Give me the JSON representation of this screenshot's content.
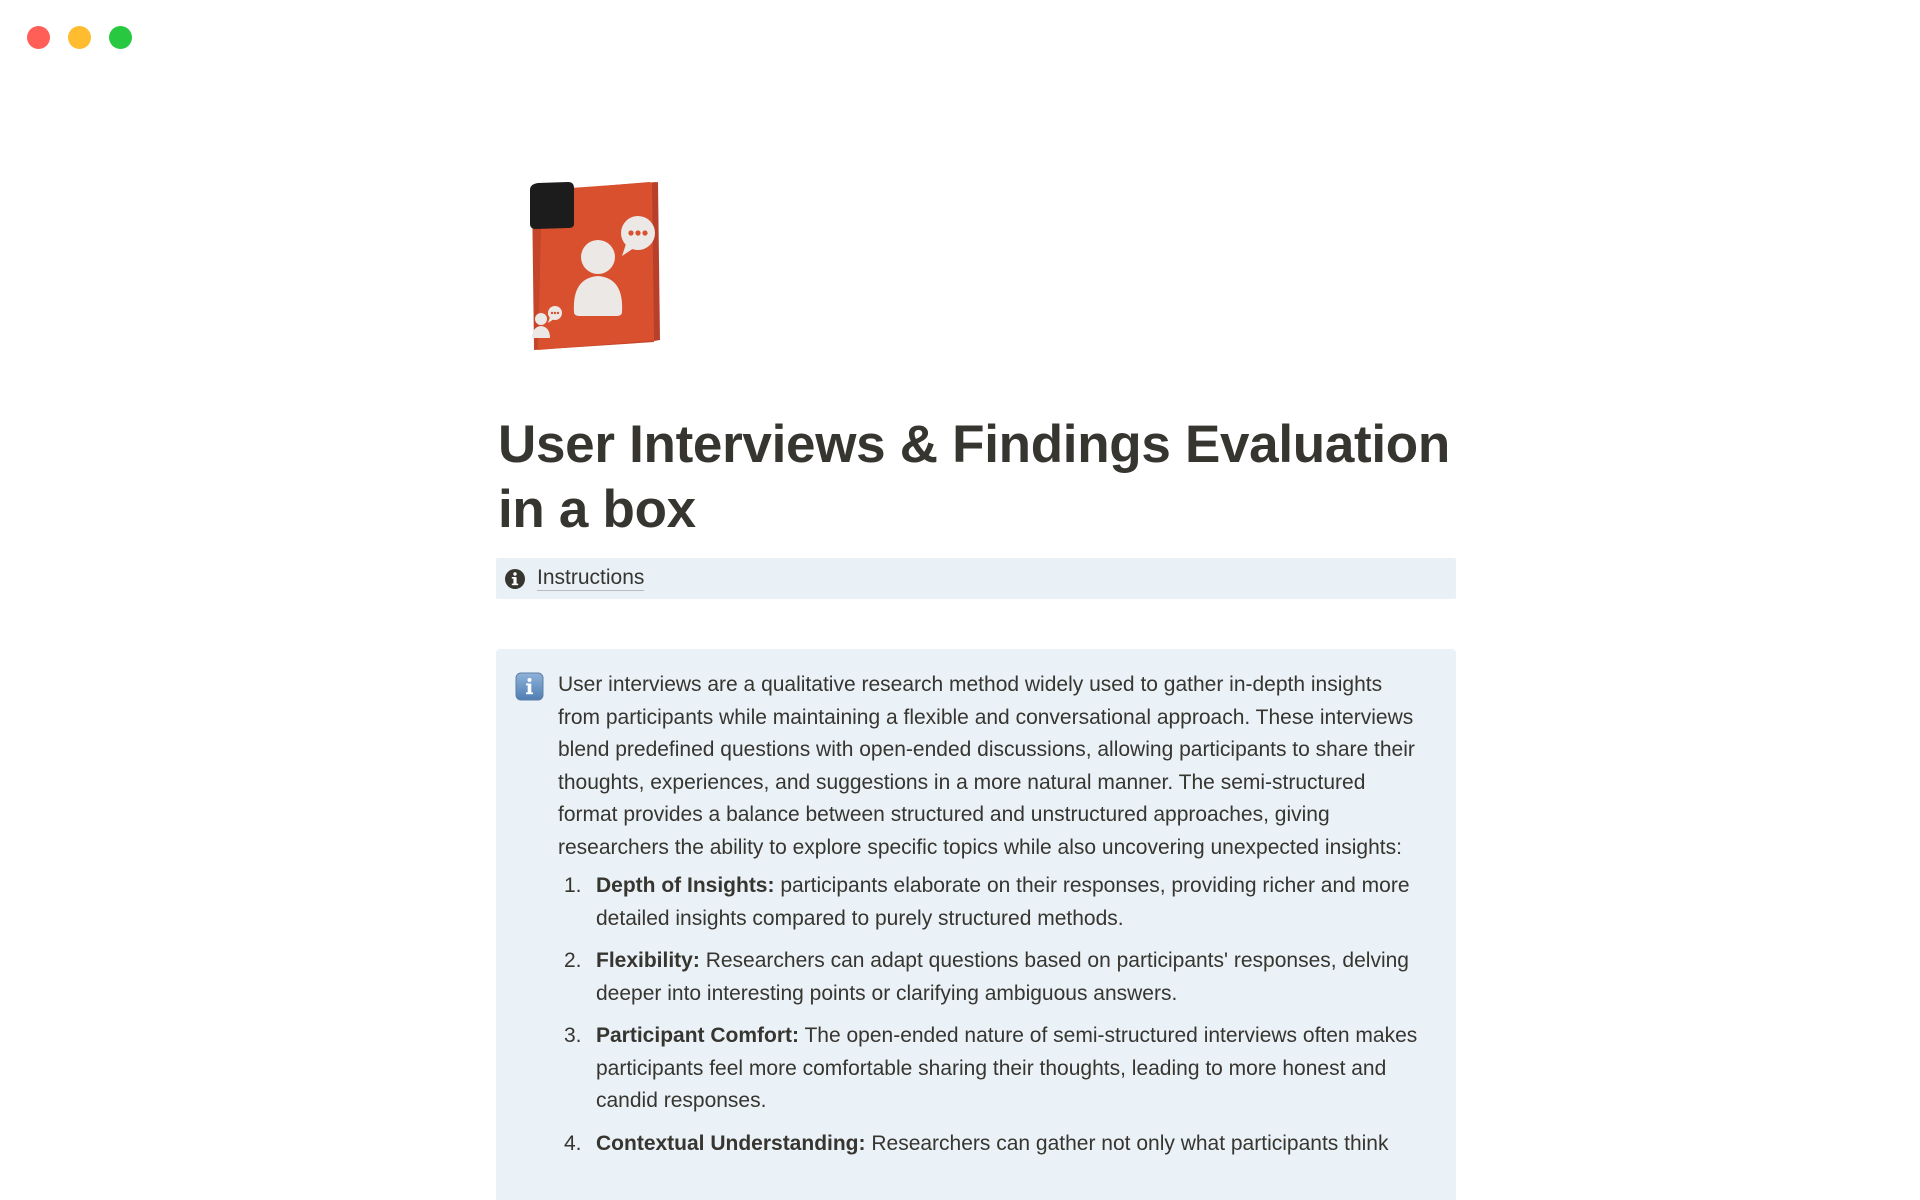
{
  "window": {
    "controls": [
      "close",
      "minimize",
      "maximize"
    ]
  },
  "page": {
    "icon": "orange-box-with-user-speech-bubbles-icon",
    "title": "User Interviews & Findings Evaluation in a box"
  },
  "toggle": {
    "icon": "info-circle-icon",
    "label": "Instructions"
  },
  "callout": {
    "icon": "information-square-icon",
    "intro": "User interviews are a qualitative research method widely used to gather in-depth insights from participants while maintaining a flexible and conversational approach. These interviews blend predefined questions with open-ended discussions, allowing participants to share their thoughts, experiences, and suggestions in a more natural manner. The semi-structured format provides a balance between structured and unstructured approaches, giving researchers the ability to explore specific topics while also uncovering unexpected insights:",
    "items": [
      {
        "number": "1.",
        "term": "Depth of Insights:",
        "text": " participants elaborate on their responses, providing richer and more detailed insights compared to purely structured methods."
      },
      {
        "number": "2.",
        "term": "Flexibility:",
        "text": " Researchers can adapt questions based on participants' responses, delving deeper into interesting points or clarifying ambiguous answers."
      },
      {
        "number": "3.",
        "term": "Participant Comfort:",
        "text": " The open-ended nature of semi-structured interviews often makes participants feel more comfortable sharing their thoughts, leading to more honest and candid responses."
      },
      {
        "number": "4.",
        "term": "Contextual Understanding:",
        "text": " Researchers can gather not only what participants think"
      }
    ]
  },
  "colors": {
    "callout_bg": "#eaf1f7",
    "toggle_bg": "#e9f1f7",
    "text": "#37352f",
    "box_orange": "#d9502e"
  }
}
